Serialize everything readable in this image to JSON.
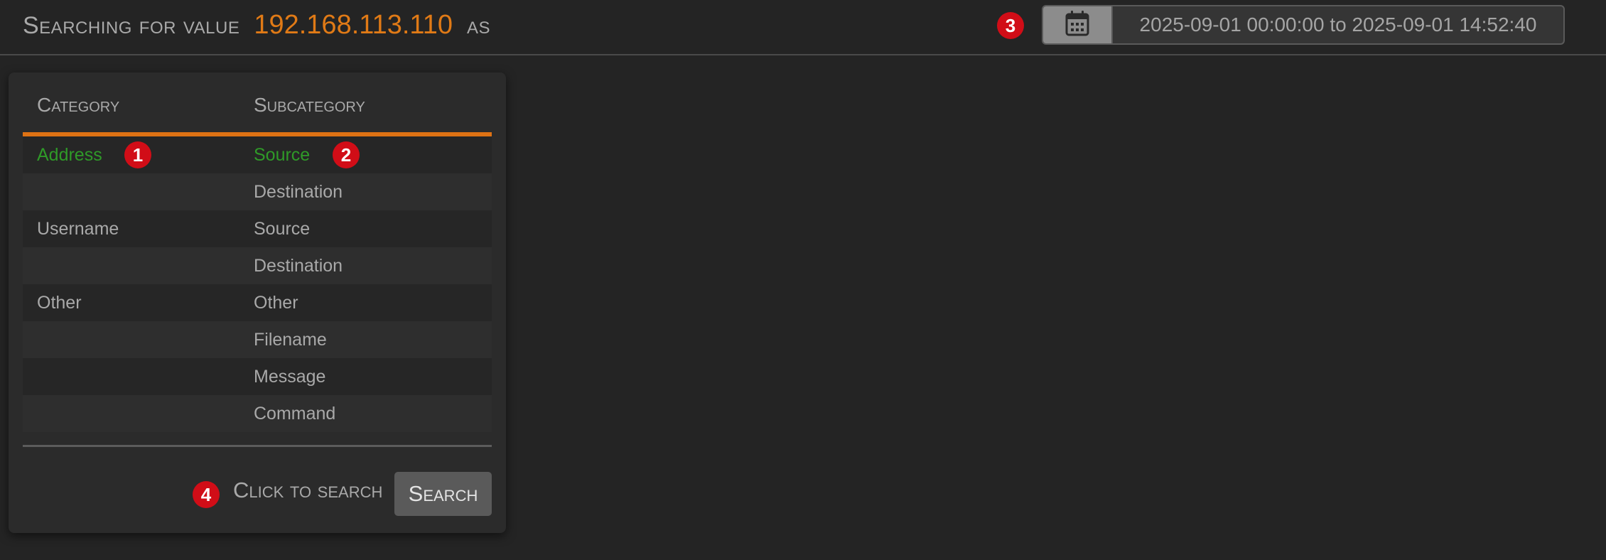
{
  "header": {
    "prefix": "Searching for value",
    "value": "192.168.113.110",
    "suffix": "as",
    "value_color": "#e07a16"
  },
  "date_range": {
    "icon": "calendar-icon",
    "text": "2025-09-01 00:00:00 to 2025-09-01 14:52:40"
  },
  "table": {
    "headers": {
      "category": "Category",
      "subcategory": "Subcategory"
    },
    "accent_color": "#de7214",
    "selected_color": "#2f9a28",
    "rows": [
      {
        "category": "Address",
        "subcategory": "Source",
        "selected": true
      },
      {
        "category": "",
        "subcategory": "Destination"
      },
      {
        "category": "Username",
        "subcategory": "Source"
      },
      {
        "category": "",
        "subcategory": "Destination"
      },
      {
        "category": "Other",
        "subcategory": "Other"
      },
      {
        "category": "",
        "subcategory": "Filename"
      },
      {
        "category": "",
        "subcategory": "Message"
      },
      {
        "category": "",
        "subcategory": "Command"
      }
    ]
  },
  "footer": {
    "hint": "Click to search",
    "search_label": "Search"
  },
  "badges": [
    "1",
    "2",
    "3",
    "4"
  ],
  "badge_color": "#d10d17"
}
